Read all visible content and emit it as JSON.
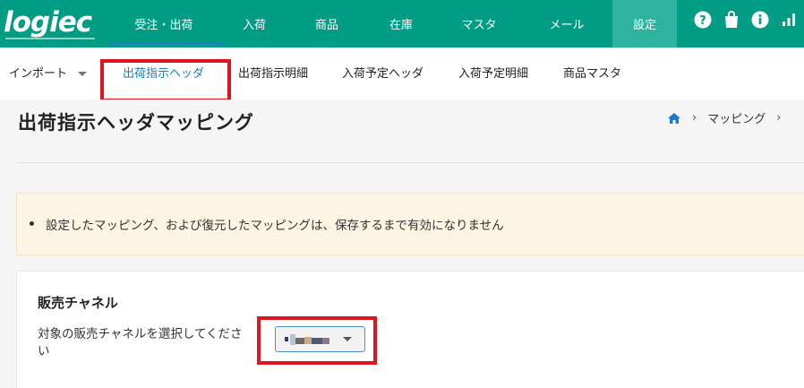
{
  "brand": {
    "name": "logiec"
  },
  "nav": {
    "items": [
      "受注・出荷",
      "入荷",
      "商品",
      "在庫",
      "マスタ",
      "メール",
      "設定"
    ],
    "active": "設定"
  },
  "icons": [
    "help-icon",
    "shopping-bag-icon",
    "info-icon",
    "signal-icon"
  ],
  "subnav": {
    "import_label": "インポート",
    "tabs": [
      "出荷指示ヘッダ",
      "出荷指示明細",
      "入荷予定ヘッダ",
      "入荷予定明細",
      "商品マスタ"
    ]
  },
  "page": {
    "title": "出荷指示ヘッダマッピング",
    "breadcrumb": "マッピング"
  },
  "notice": {
    "text": "設定したマッピング、および復元したマッピングは、保存するまで有効になりません"
  },
  "channel": {
    "title": "販売チャネル",
    "label": "対象の販売チャネルを選択してください"
  },
  "colors": {
    "header": "#009c84",
    "active_tab": "#1a7cd0",
    "highlight": "#e0141e"
  }
}
